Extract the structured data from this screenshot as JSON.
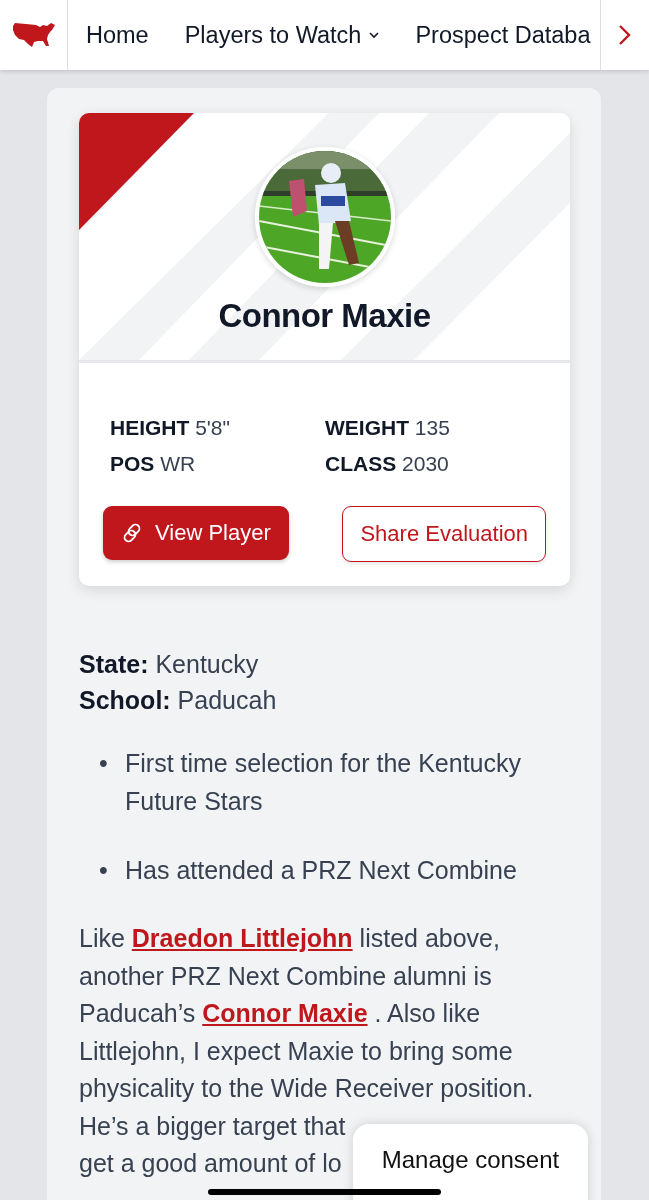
{
  "nav": {
    "items": [
      {
        "label": "Home",
        "dropdown": false
      },
      {
        "label": "Players to Watch",
        "dropdown": true
      },
      {
        "label": "Prospect Databa",
        "dropdown": false
      }
    ]
  },
  "player": {
    "name": "Connor Maxie",
    "stats": [
      {
        "label": "HEIGHT",
        "value": "5'8\""
      },
      {
        "label": "WEIGHT",
        "value": "135"
      },
      {
        "label": "POS",
        "value": "WR"
      },
      {
        "label": "CLASS",
        "value": "2030"
      }
    ],
    "buttons": [
      {
        "label": "View Player",
        "kind": "primary"
      },
      {
        "label": "Share Evaluation",
        "kind": "outline"
      }
    ]
  },
  "details": [
    {
      "label": "State:",
      "value": "Kentucky"
    },
    {
      "label": "School:",
      "value": "Paducah"
    }
  ],
  "bullets": [
    {
      "marker": "•",
      "text": "First time selection for the Kentucky Future Stars"
    },
    {
      "marker": "•",
      "text": "Has attended a PRZ Next Combine"
    }
  ],
  "paragraph": [
    [
      {
        "text": "Like "
      },
      {
        "text": "Draedon Littlejohn",
        "link": true
      },
      {
        "text": " listed above,"
      }
    ],
    [
      {
        "text": "another PRZ Next Combine alumni is"
      }
    ],
    [
      {
        "text": "Paducah’s "
      },
      {
        "text": "Connor Maxie",
        "link": true
      },
      {
        "text": " . Also like"
      }
    ],
    [
      {
        "text": "Littlejohn, I expect Maxie to bring some"
      }
    ],
    [
      {
        "text": "physicality to the Wide Receiver position."
      }
    ]
  ],
  "paragraph_tail": [
    [
      {
        "text": "He’s a bigger target that"
      }
    ],
    [
      {
        "text": "get a good amount of lo"
      }
    ]
  ],
  "consent": {
    "label": "Manage consent"
  }
}
